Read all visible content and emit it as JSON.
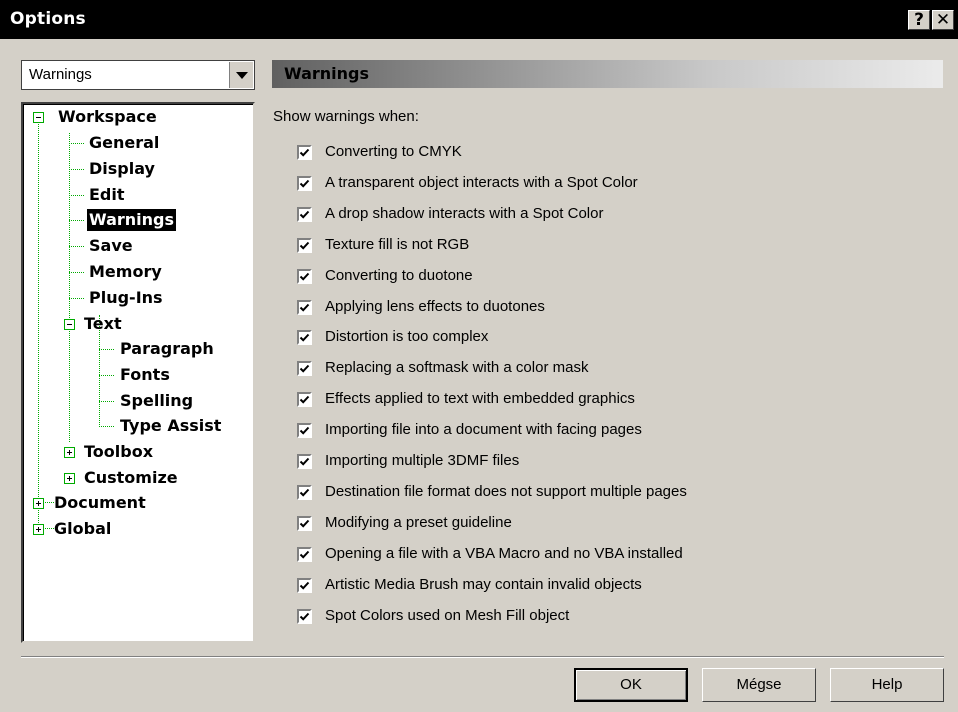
{
  "window": {
    "title": "Options",
    "help_glyph": "?",
    "close_glyph": "✕"
  },
  "category_select": {
    "value": "Warnings"
  },
  "tree": {
    "workspace": "Workspace",
    "general": "General",
    "display": "Display",
    "edit": "Edit",
    "warnings": "Warnings",
    "save": "Save",
    "memory": "Memory",
    "plugins": "Plug-Ins",
    "text": "Text",
    "paragraph": "Paragraph",
    "fonts": "Fonts",
    "spelling": "Spelling",
    "type_assist": "Type Assist",
    "toolbox": "Toolbox",
    "customize": "Customize",
    "document": "Document",
    "global": "Global",
    "selected": "Warnings"
  },
  "panel": {
    "header": "Warnings",
    "intro": "Show warnings when:"
  },
  "warnings": [
    {
      "label": "Converting to CMYK",
      "checked": true
    },
    {
      "label": "A transparent object interacts with a Spot Color",
      "checked": true
    },
    {
      "label": "A drop shadow interacts with a Spot Color",
      "checked": true
    },
    {
      "label": "Texture fill is not RGB",
      "checked": true
    },
    {
      "label": "Converting to duotone",
      "checked": true
    },
    {
      "label": "Applying lens effects to duotones",
      "checked": true
    },
    {
      "label": "Distortion is too complex",
      "checked": true
    },
    {
      "label": "Replacing a softmask with a color mask",
      "checked": true
    },
    {
      "label": "Effects applied to text with embedded graphics",
      "checked": true
    },
    {
      "label": "Importing file into a document with facing pages",
      "checked": true
    },
    {
      "label": "Importing multiple 3DMF files",
      "checked": true
    },
    {
      "label": "Destination file format does not support multiple pages",
      "checked": true
    },
    {
      "label": "Modifying a preset guideline",
      "checked": true
    },
    {
      "label": "Opening a file with a VBA Macro and no VBA installed",
      "checked": true
    },
    {
      "label": "Artistic Media Brush may contain invalid objects",
      "checked": true
    },
    {
      "label": "Spot Colors used on Mesh Fill object",
      "checked": true
    }
  ],
  "buttons": {
    "ok": "OK",
    "cancel": "Mégse",
    "help": "Help"
  },
  "colors": {
    "tree_lines": "#00aa00",
    "face": "#d4d0c8",
    "titlebar": "#000000"
  }
}
